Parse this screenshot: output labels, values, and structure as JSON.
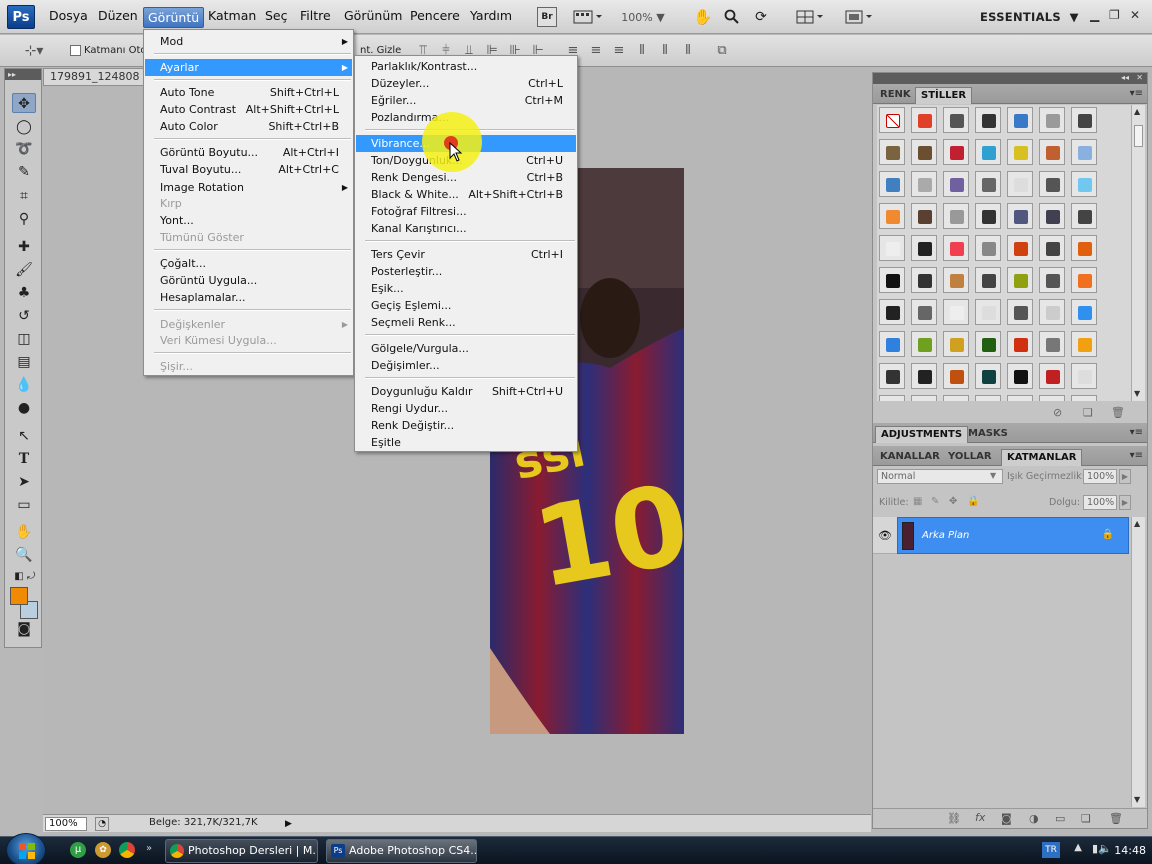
{
  "menubar": {
    "logo": "Ps",
    "items": [
      "Dosya",
      "Düzen",
      "Görüntü",
      "Katman",
      "Seç",
      "Filtre",
      "Görünüm",
      "Pencere",
      "Yardım"
    ],
    "open_item": "Görüntü",
    "zoom": "100%",
    "workspace": "ESSENTIALS",
    "bridge_label": "Br"
  },
  "options_bar": {
    "auto_select_label": "Katmanı Otor",
    "hide_label": "nt. Gizle"
  },
  "document": {
    "tab_title": "179891_124808",
    "zoom_field": "100%",
    "doc_size": "Belge: 321,7K/321,7K"
  },
  "goruntu_menu": {
    "items": [
      {
        "label": "Mod",
        "shortcut": "",
        "submenu": true,
        "disabled": false
      },
      {
        "label": "Ayarlar",
        "shortcut": "",
        "submenu": true,
        "disabled": false,
        "highlighted": true
      },
      {
        "label": "Auto Tone",
        "shortcut": "Shift+Ctrl+L",
        "disabled": false
      },
      {
        "label": "Auto Contrast",
        "shortcut": "Alt+Shift+Ctrl+L",
        "disabled": false
      },
      {
        "label": "Auto Color",
        "shortcut": "Shift+Ctrl+B",
        "disabled": false
      },
      {
        "label": "Görüntü Boyutu...",
        "shortcut": "Alt+Ctrl+I",
        "disabled": false
      },
      {
        "label": "Tuval Boyutu...",
        "shortcut": "Alt+Ctrl+C",
        "disabled": false
      },
      {
        "label": "Image Rotation",
        "shortcut": "",
        "submenu": true,
        "disabled": false
      },
      {
        "label": "Kırp",
        "shortcut": "",
        "disabled": true
      },
      {
        "label": "Yont...",
        "shortcut": "",
        "disabled": false
      },
      {
        "label": "Tümünü Göster",
        "shortcut": "",
        "disabled": true
      },
      {
        "label": "Çoğalt...",
        "shortcut": "",
        "disabled": false
      },
      {
        "label": "Görüntü Uygula...",
        "shortcut": "",
        "disabled": false
      },
      {
        "label": "Hesaplamalar...",
        "shortcut": "",
        "disabled": false
      },
      {
        "label": "Değişkenler",
        "shortcut": "",
        "submenu": true,
        "disabled": true
      },
      {
        "label": "Veri Kümesi Uygula...",
        "shortcut": "",
        "disabled": true
      },
      {
        "label": "Şişir...",
        "shortcut": "",
        "disabled": true
      }
    ]
  },
  "ayarlar_menu": {
    "items": [
      {
        "label": "Parlaklık/Kontrast...",
        "shortcut": ""
      },
      {
        "label": "Düzeyler...",
        "shortcut": "Ctrl+L"
      },
      {
        "label": "Eğriler...",
        "shortcut": "Ctrl+M"
      },
      {
        "label": "Pozlandırma...",
        "shortcut": ""
      },
      {
        "label": "Vibrance...",
        "shortcut": "",
        "highlighted": true
      },
      {
        "label": "Ton/Doygunluk...",
        "shortcut": "Ctrl+U"
      },
      {
        "label": "Renk Dengesi...",
        "shortcut": "Ctrl+B"
      },
      {
        "label": "Black & White...",
        "shortcut": "Alt+Shift+Ctrl+B"
      },
      {
        "label": "Fotoğraf Filtresi...",
        "shortcut": ""
      },
      {
        "label": "Kanal Karıştırıcı...",
        "shortcut": ""
      },
      {
        "label": "Ters Çevir",
        "shortcut": "Ctrl+I"
      },
      {
        "label": "Posterleştir...",
        "shortcut": ""
      },
      {
        "label": "Eşik...",
        "shortcut": ""
      },
      {
        "label": "Geçiş Eşlemi...",
        "shortcut": ""
      },
      {
        "label": "Seçmeli Renk...",
        "shortcut": ""
      },
      {
        "label": "Gölgele/Vurgula...",
        "shortcut": ""
      },
      {
        "label": "Değişimler...",
        "shortcut": ""
      },
      {
        "label": "Doygunluğu Kaldır",
        "shortcut": "Shift+Ctrl+U"
      },
      {
        "label": "Rengi Uydur...",
        "shortcut": ""
      },
      {
        "label": "Renk Değiştir...",
        "shortcut": ""
      },
      {
        "label": "Eşitle",
        "shortcut": ""
      }
    ]
  },
  "panels": {
    "color_styles_tabs": [
      "RENK",
      "STİLLER"
    ],
    "adjust_tabs": [
      "ADJUSTMENTS",
      "MASKS"
    ],
    "layer_tabs": [
      "KANALLAR",
      "YOLLAR",
      "KATMANLAR"
    ],
    "blend_mode": "Normal",
    "opacity_label": "Işık Geçirmezlik:",
    "opacity_value": "100%",
    "lock_label": "Kilitle:",
    "fill_label": "Dolgu:",
    "fill_value": "100%",
    "layer_name": "Arka Plan"
  },
  "taskbar": {
    "buttons": [
      "Photoshop Dersleri | M...",
      "Adobe Photoshop CS4..."
    ],
    "lang": "TR",
    "clock": "14:48"
  },
  "colors": {
    "foreground": "#f08a00",
    "background": "#b9cfe0",
    "menu_highlight": "#3399ff"
  }
}
